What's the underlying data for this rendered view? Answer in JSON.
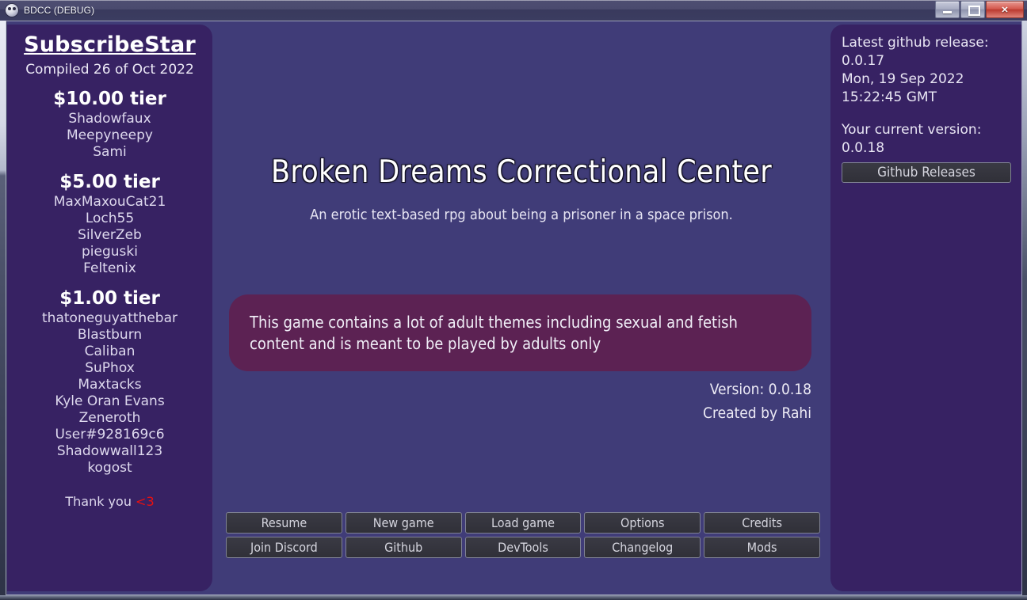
{
  "window": {
    "title": "BDCC (DEBUG)",
    "icon": "app-mask-icon",
    "controls": {
      "minimize": "minimize-icon",
      "maximize": "maximize-icon",
      "close": "✕"
    }
  },
  "colors": {
    "viewport_bg": "#403c78",
    "panel_bg": "#372263",
    "warning_bg": "#5c2253",
    "button_bg": "#343440",
    "button_border": "#7f8293",
    "heart_red": "#e81010",
    "titlebar_top": "#4e4e72",
    "titlebar_bottom": "#3b3c60"
  },
  "sidebar": {
    "platform": "SubscribeStar",
    "compiled": "Compiled 26 of Oct 2022",
    "tiers": [
      {
        "title": "$10.00 tier",
        "supporters": [
          "Shadowfaux",
          "Meepyneepy",
          "Sami"
        ]
      },
      {
        "title": "$5.00 tier",
        "supporters": [
          "MaxMaxouCat21",
          "Loch55",
          "SilverZeb",
          "pieguski",
          "Feltenix"
        ]
      },
      {
        "title": "$1.00 tier",
        "supporters": [
          "thatoneguyatthebar",
          "Blastburn",
          "Caliban",
          "SuPhox",
          "Maxtacks",
          "Kyle Oran Evans",
          "Zeneroth",
          "User#928169c6",
          "Shadowwall123",
          "kogost"
        ]
      }
    ],
    "thank_you": "Thank you ",
    "heart": "<3"
  },
  "main": {
    "title": "Broken Dreams Correctional Center",
    "subtitle": "An erotic text-based rpg about being a prisoner in a space prison.",
    "warning": "This game contains a lot of adult themes including sexual and fetish content and is meant to be played by adults only",
    "version_line": "Version: 0.0.18",
    "author_line": "Created by Rahi",
    "buttons": [
      "Resume",
      "New game",
      "Load game",
      "Options",
      "Credits",
      "Join Discord",
      "Github",
      "DevTools",
      "Changelog",
      "Mods"
    ]
  },
  "right_panel": {
    "latest_label": "Latest github release:",
    "latest_version": "0.0.17",
    "latest_date": "Mon, 19 Sep 2022",
    "latest_time": "15:22:45 GMT",
    "current_label": "Your current version:",
    "current_version": "0.0.18",
    "github_button": "Github Releases"
  }
}
